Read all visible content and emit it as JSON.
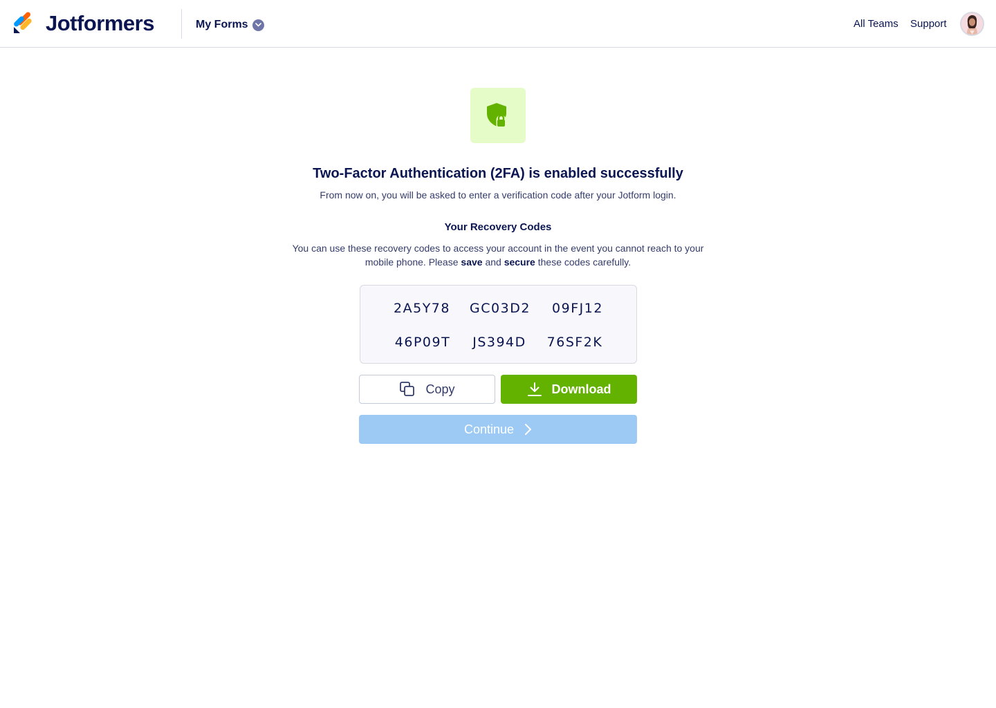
{
  "header": {
    "brand": "Jotformers",
    "my_forms_label": "My Forms",
    "nav": {
      "all_teams": "All Teams",
      "support": "Support"
    }
  },
  "main": {
    "title": "Two-Factor Authentication (2FA) is enabled successfully",
    "subtitle": "From now on, you will be asked to enter a verification code after your Jotform login.",
    "recovery": {
      "heading": "Your Recovery Codes",
      "desc_part1": "You can use these recovery codes to access your account in the event you cannot reach to your mobile phone. Please ",
      "desc_save": "save",
      "desc_and": " and ",
      "desc_secure": "secure",
      "desc_part2": " these codes carefully.",
      "codes": [
        "2A5Y78",
        "GC03D2",
        "09FJ12",
        "46P09T",
        "JS394D",
        "76SF2K"
      ]
    },
    "buttons": {
      "copy": "Copy",
      "download": "Download",
      "continue": "Continue"
    }
  },
  "icons": {
    "logo": "jotform-logo-icon",
    "status": "shield-lock-icon",
    "copy": "copy-icon",
    "download": "download-icon",
    "continue": "chevron-right-icon",
    "dropdown": "chevron-down-icon"
  },
  "colors": {
    "navy": "#0a1551",
    "green": "#64b200",
    "light_green_bg": "#e5fbc8",
    "continue_disabled": "#9ccaf4",
    "border": "#d8dae3"
  }
}
